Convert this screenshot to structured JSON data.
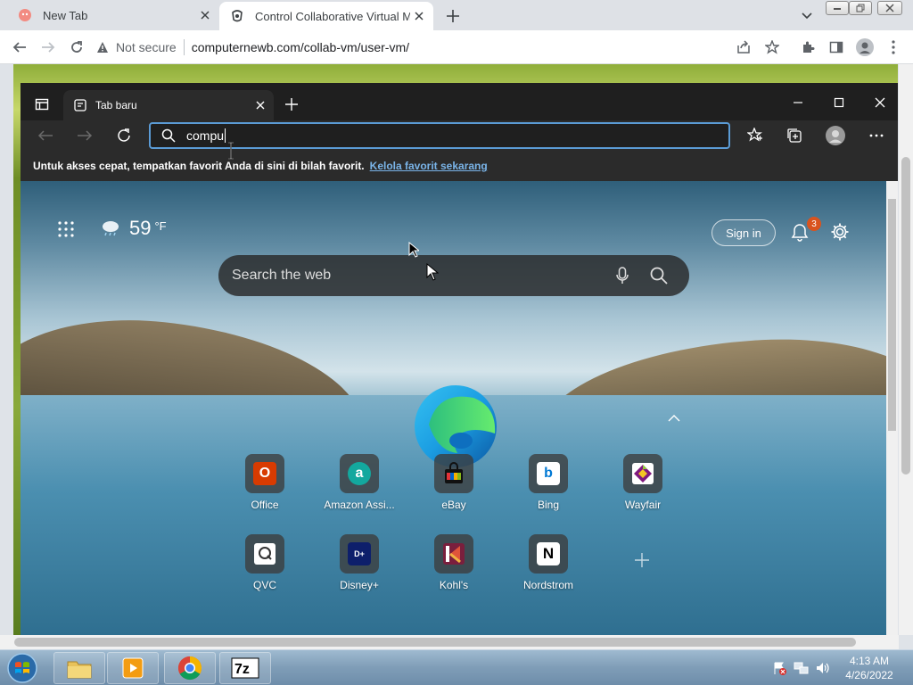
{
  "chrome": {
    "tabs": [
      {
        "title": "New Tab",
        "active": false
      },
      {
        "title": "Control Collaborative Virtual Ma",
        "active": true
      }
    ],
    "security_label": "Not secure",
    "url": "computernewb.com/collab-vm/user-vm/"
  },
  "edge": {
    "tab_title": "Tab baru",
    "address_value": "compu",
    "favbar_text": "Untuk akses cepat, tempatkan favorit Anda di sini di bilah favorit.",
    "favbar_link": "Kelola favorit sekarang"
  },
  "ntp": {
    "weather_temp": "59",
    "weather_unit": "°F",
    "sign_in": "Sign in",
    "notification_count": "3",
    "search_placeholder": "Search the web",
    "tiles_row1": [
      {
        "label": "Office",
        "icon": "office-icon",
        "color": "#d83b01"
      },
      {
        "label": "Amazon Assi...",
        "icon": "amazon-assistant-icon",
        "color": "#13a89e"
      },
      {
        "label": "eBay",
        "icon": "ebay-icon",
        "color": "#e53238"
      },
      {
        "label": "Bing",
        "icon": "bing-icon",
        "color": "#0078d4"
      },
      {
        "label": "Wayfair",
        "icon": "wayfair-icon",
        "color": "#7f187f"
      }
    ],
    "tiles_row2": [
      {
        "label": "QVC",
        "icon": "qvc-icon",
        "color": "#333333"
      },
      {
        "label": "Disney+",
        "icon": "disney-plus-icon",
        "color": "#113ccf"
      },
      {
        "label": "Kohl's",
        "icon": "kohls-icon",
        "color": "#7a1f3d"
      },
      {
        "label": "Nordstrom",
        "icon": "nordstrom-icon",
        "color": "#000000"
      }
    ]
  },
  "taskbar": {
    "time": "4:13 AM",
    "date": "4/26/2022"
  }
}
